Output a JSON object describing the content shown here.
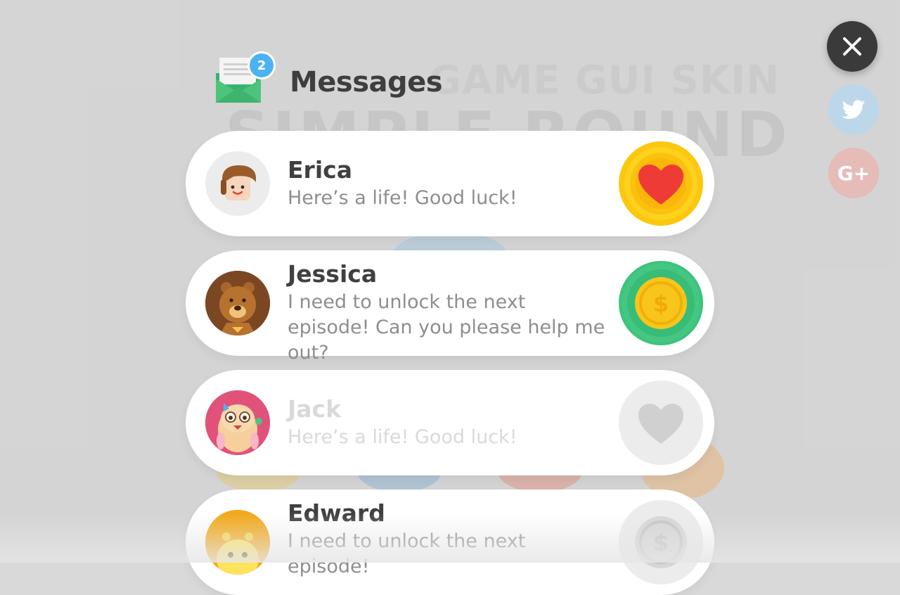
{
  "background": {
    "subtitle": "GAME GUI SKIN",
    "title": "SIMPLE ROUND"
  },
  "header": {
    "title": "Messages",
    "badge_count": "2",
    "icon": "envelope-icon"
  },
  "close_button": {
    "icon": "close-icon"
  },
  "social": {
    "twitter_icon": "twitter-icon",
    "gplus_label": "G+"
  },
  "messages": [
    {
      "name": "Erica",
      "text": "Here’s a life! Good luck!",
      "action": "heart-icon",
      "action_color": "#fbc70f",
      "state": "active"
    },
    {
      "name": "Jessica",
      "text": "I need to unlock the next episode! Can you please help me out?",
      "action": "coin-icon",
      "action_color": "#3cc47c",
      "state": "active"
    },
    {
      "name": "Jack",
      "text": "Here’s a life! Good luck!",
      "action": "heart-icon",
      "action_color": "#ececec",
      "state": "disabled"
    },
    {
      "name": "Edward",
      "text": "I need to unlock the next episode!",
      "action": "coin-icon",
      "action_color": "#ececec",
      "state": "disabled"
    }
  ],
  "coin_symbol": "$",
  "colors": {
    "badge": "#4db2f4",
    "heart_red": "#ef3b36",
    "coin_gold": "#f8c51c",
    "close_bg": "#3a3a3a"
  }
}
